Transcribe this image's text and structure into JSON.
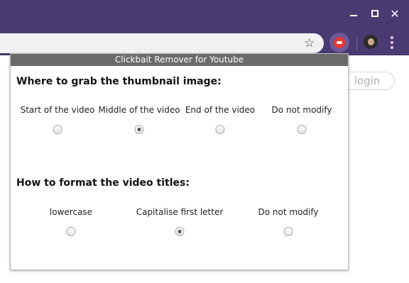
{
  "browser": {
    "minimize_icon": "minimize-icon",
    "maximize_icon": "maximize-icon",
    "close_icon": "close-icon",
    "close_glyph": "✕",
    "star_icon": "star-icon",
    "star_glyph": "☆",
    "extension_icon": "clickbait-remover-icon",
    "menu_icon": "kebab-menu-icon",
    "accent": "#4a3a72"
  },
  "page": {
    "login_label": "login"
  },
  "popup": {
    "title": "Clickbait Remover for Youtube",
    "thumbnail_section": {
      "heading": "Where to grab the thumbnail image:",
      "options": [
        {
          "label": "Start of the video",
          "checked": false
        },
        {
          "label": "Middle of the video",
          "checked": true
        },
        {
          "label": "End of the video",
          "checked": false
        },
        {
          "label": "Do not modify",
          "checked": false
        }
      ]
    },
    "title_section": {
      "heading": "How to format the video titles:",
      "options": [
        {
          "label": "lowercase",
          "checked": false
        },
        {
          "label": "Capitalise first letter",
          "checked": true
        },
        {
          "label": "Do not modify",
          "checked": false
        }
      ]
    }
  }
}
